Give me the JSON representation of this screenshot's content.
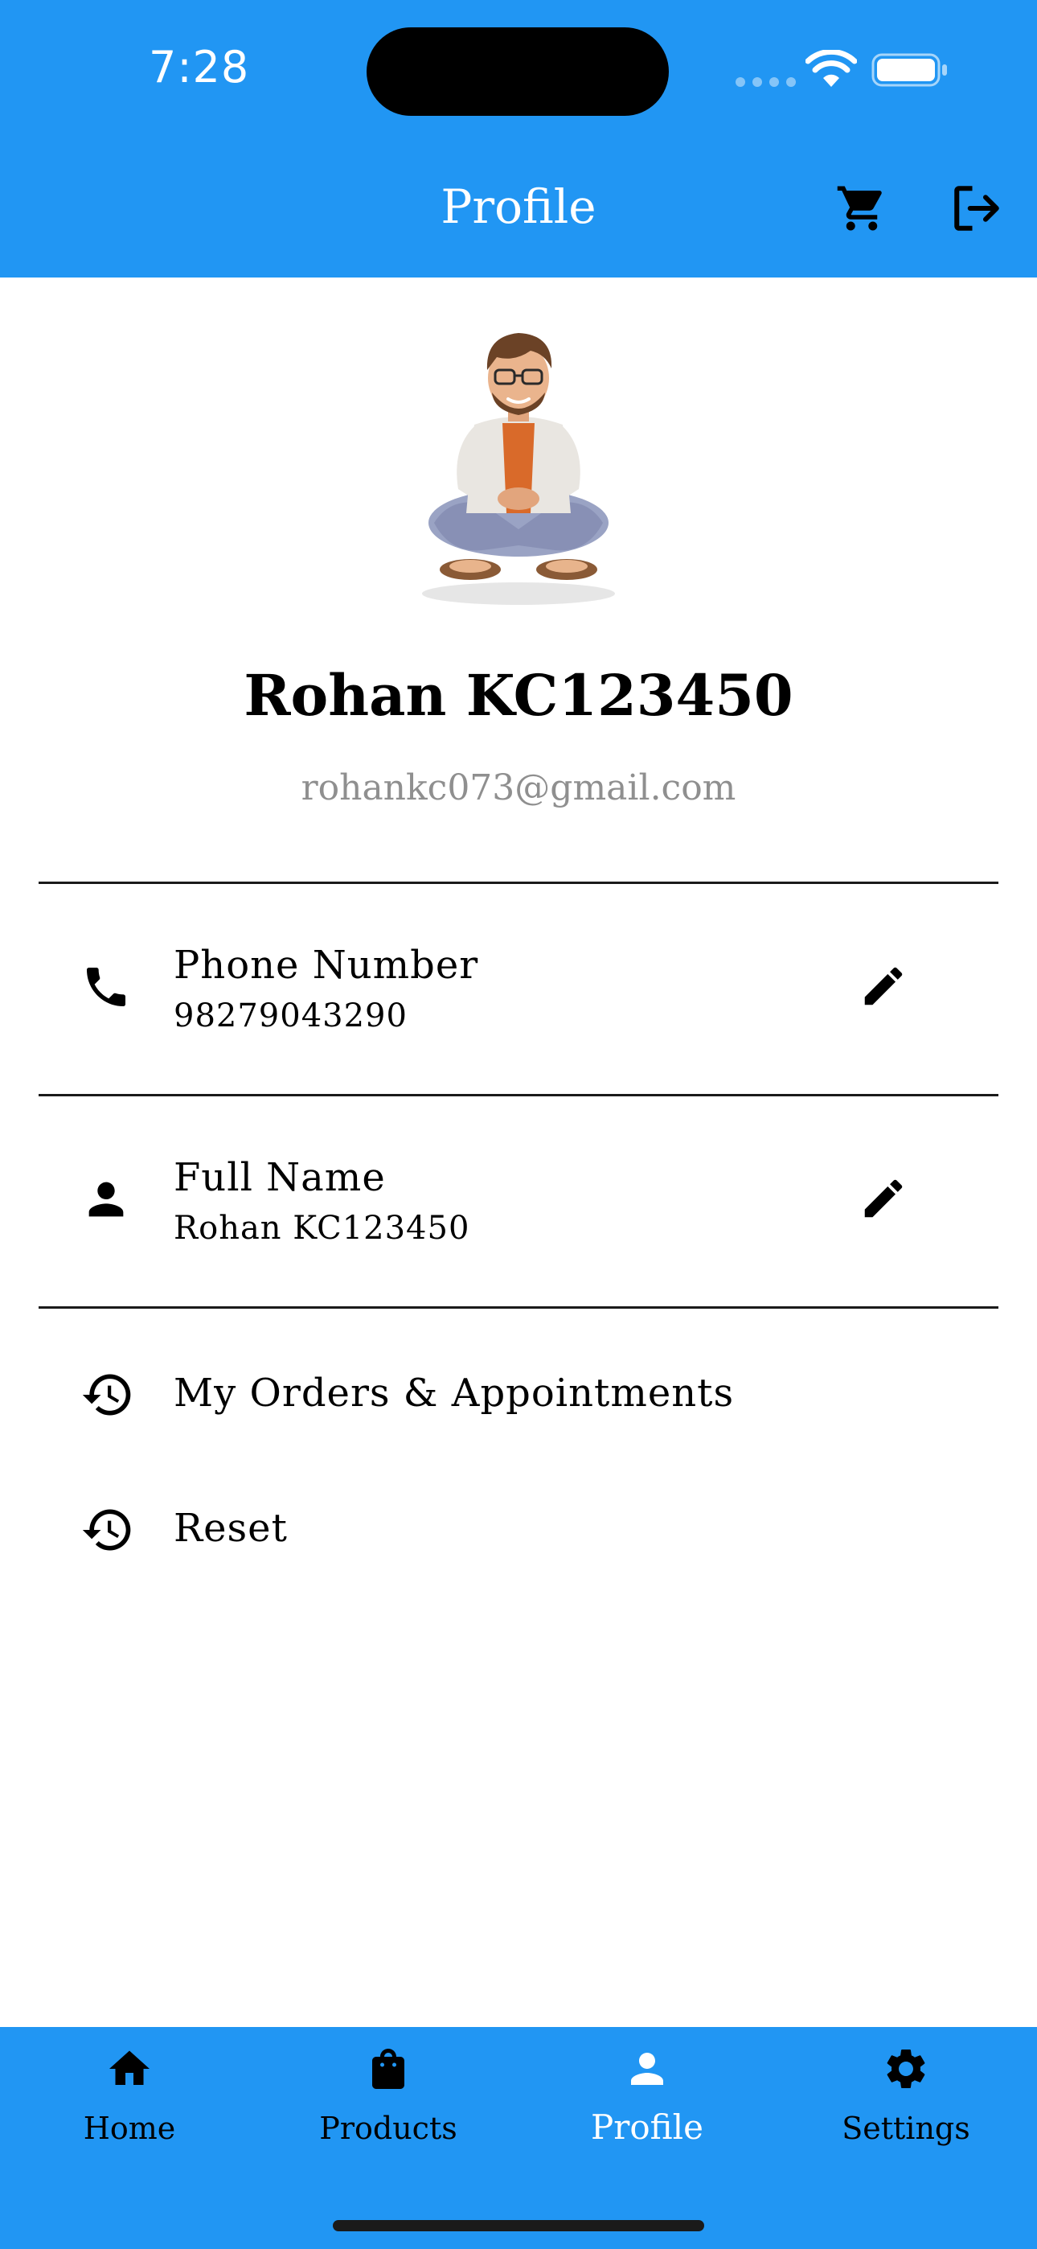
{
  "status_bar": {
    "time": "7:28"
  },
  "header": {
    "title": "Profile",
    "cart_icon": "cart-icon",
    "logout_icon": "logout-icon"
  },
  "profile": {
    "name": "Rohan KC123450",
    "email": "rohankc073@gmail.com",
    "avatar": "cartoon-avatar"
  },
  "details": [
    {
      "icon": "phone-icon",
      "title": "Phone Number",
      "value": "98279043290",
      "action_icon": "edit-icon"
    },
    {
      "icon": "person-icon",
      "title": "Full Name",
      "value": "Rohan KC123450",
      "action_icon": "edit-icon"
    }
  ],
  "menu": [
    {
      "icon": "history-icon",
      "label": "My Orders & Appointments"
    },
    {
      "icon": "history-icon",
      "label": "Reset"
    }
  ],
  "bottom_nav": {
    "items": [
      {
        "icon": "home-icon",
        "label": "Home"
      },
      {
        "icon": "shopping-bag-icon",
        "label": "Products"
      },
      {
        "icon": "person-icon",
        "label": "Profile"
      },
      {
        "icon": "gear-icon",
        "label": "Settings"
      }
    ],
    "active": "Profile"
  },
  "colors": {
    "primary": "#2196F3",
    "background": "#ffffff",
    "email_text": "#8f8f8f",
    "text": "#000000"
  }
}
